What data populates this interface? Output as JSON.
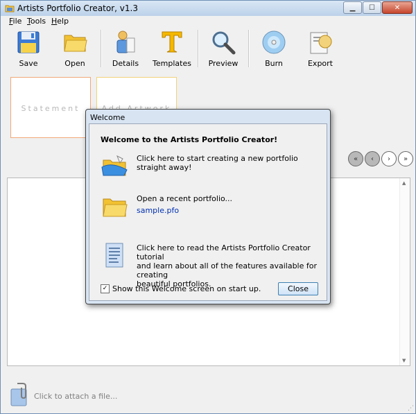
{
  "window": {
    "title": "Artists Portfolio Creator, v1.3",
    "controls": {
      "minimize": "▁",
      "maximize": "☐",
      "close": "✕"
    }
  },
  "menu": [
    {
      "label": "File",
      "accel": "F",
      "rest": "ile"
    },
    {
      "label": "Tools",
      "accel": "T",
      "rest": "ools"
    },
    {
      "label": "Help",
      "accel": "H",
      "rest": "elp"
    }
  ],
  "toolbar": {
    "save": "Save",
    "open": "Open",
    "details": "Details",
    "templates": "Templates",
    "preview": "Preview",
    "burn": "Burn",
    "export": "Export"
  },
  "thumbnails": [
    {
      "label": "Statement"
    },
    {
      "label": "Add Artwork"
    }
  ],
  "nav": {
    "first": "«",
    "prev": "‹",
    "next": "›",
    "last": "»"
  },
  "attach": {
    "text": "Click to attach a file..."
  },
  "dialog": {
    "title": "Welcome",
    "heading": "Welcome to the Artists Portfolio Creator!",
    "new_text": "Click here to start creating a new portfolio straight away!",
    "recent_text": "Open a recent portfolio...",
    "recent_file": "sample.pfo",
    "tutorial_line1": "Click here to read the Artists Portfolio Creator tutorial",
    "tutorial_line2": "and learn about all of the features available for creating",
    "tutorial_line3": "beautiful portfolios.",
    "show_on_startup": "Show this Welcome screen on start up.",
    "show_checked": "✓",
    "close": "Close"
  },
  "colors": {
    "accent": "#0030b0",
    "statement_border": "#f0a878",
    "artwork_border": "#f2d27a"
  }
}
